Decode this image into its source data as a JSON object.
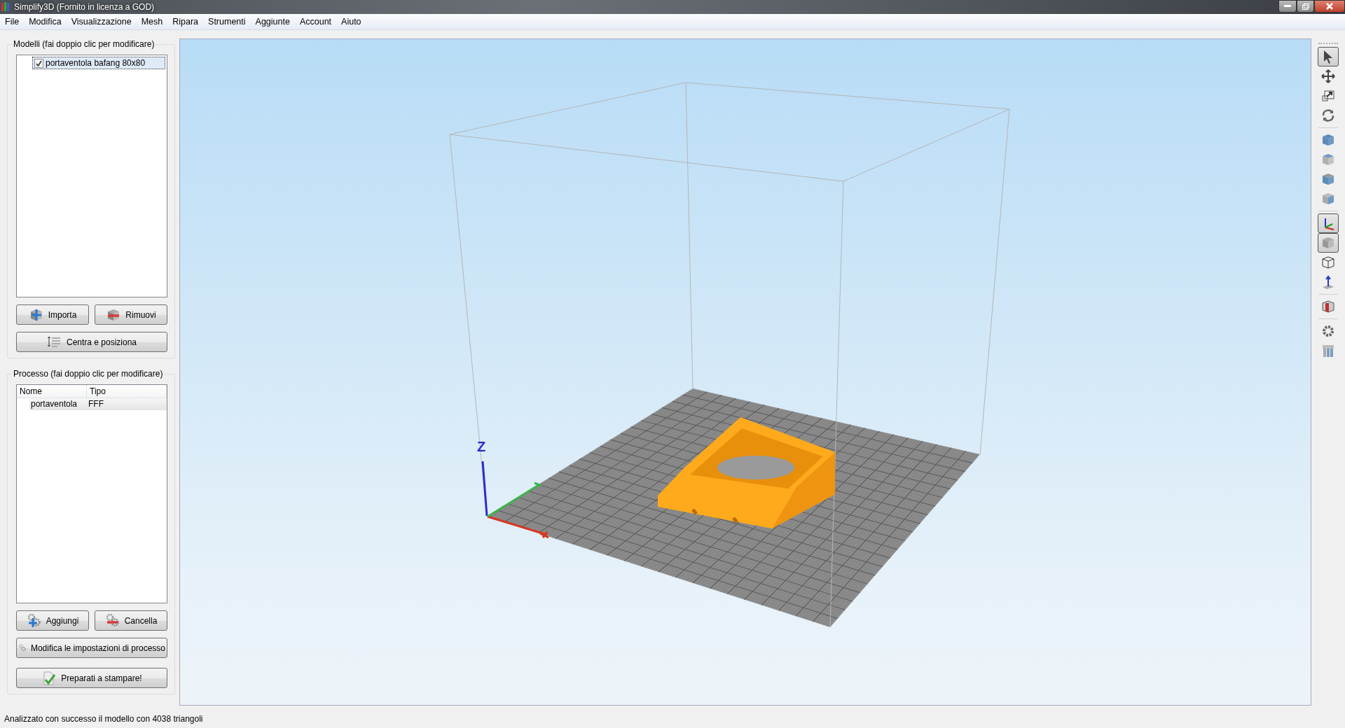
{
  "window": {
    "title": "Simplify3D (Fornito in licenza a GOD)"
  },
  "menu": [
    "File",
    "Modifica",
    "Visualizzazione",
    "Mesh",
    "Ripara",
    "Strumenti",
    "Aggiunte",
    "Account",
    "Aiuto"
  ],
  "models": {
    "title": "Modelli (fai doppio clic per modificare)",
    "items": [
      {
        "label": "portaventola bafang 80x80",
        "checked": true,
        "selected": true
      }
    ],
    "buttons": [
      {
        "kind": "import",
        "label": "Importa"
      },
      {
        "kind": "remove",
        "label": "Rimuovi"
      },
      {
        "kind": "center",
        "label": "Centra e posiziona"
      }
    ]
  },
  "processes": {
    "title": "Processo (fai doppio clic per modificare)",
    "columns": [
      "Nome",
      "Tipo"
    ],
    "rows": [
      {
        "cells": [
          "portaventola",
          "FFF"
        ],
        "selected": true
      }
    ],
    "buttons": [
      {
        "kind": "add",
        "label": "Aggiungi"
      },
      {
        "kind": "delete",
        "label": "Cancella"
      },
      {
        "kind": "edit",
        "label": "Modifica le impostazioni di processo"
      },
      {
        "kind": "prepare",
        "label": "Preparati a stampare!"
      }
    ]
  },
  "viewport": {
    "axis_label": "Z"
  },
  "toolbar": [
    [
      {
        "kind": "select",
        "selected": true
      },
      {
        "kind": "move",
        "selected": false
      },
      {
        "kind": "scale",
        "selected": false
      },
      {
        "kind": "rotate",
        "selected": false
      }
    ],
    [
      {
        "kind": "cube-top",
        "selected": false
      },
      {
        "kind": "cube-front",
        "selected": false
      },
      {
        "kind": "cube-side",
        "selected": false
      },
      {
        "kind": "cube-right",
        "selected": false
      }
    ],
    [
      {
        "kind": "axes",
        "selected": true
      },
      {
        "kind": "solid",
        "selected": true
      },
      {
        "kind": "wire",
        "selected": false
      },
      {
        "kind": "normal",
        "selected": false
      }
    ],
    [
      {
        "kind": "section",
        "selected": false
      }
    ],
    [
      {
        "kind": "gear",
        "selected": false
      },
      {
        "kind": "supports",
        "selected": false
      }
    ]
  ],
  "status_bar": "Analizzato con successo il modello con 4038 triangoli"
}
